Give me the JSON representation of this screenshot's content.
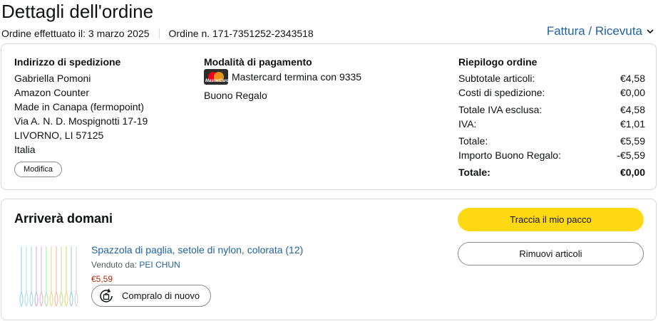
{
  "header": {
    "title": "Dettagli dell'ordine",
    "order_date": "Ordine effettuato il: 3 marzo 2025",
    "order_number": "Ordine n. 171-7351252-2343518",
    "invoice_link": "Fattura / Ricevuta"
  },
  "shipping": {
    "heading": "Indirizzo di spedizione",
    "lines": [
      "Gabriella Pomoni",
      "Amazon Counter",
      "Made in Canapa (fermopoint)",
      "Via A. N. D. Mospignotti 17-19",
      "LIVORNO, LI 57125",
      "Italia"
    ],
    "modify_label": "Modifica"
  },
  "payment": {
    "heading": "Modalità di pagamento",
    "card_text": "Mastercard termina con 9335",
    "card_logo_text": "MasterCard",
    "gift_card": "Buono Regalo"
  },
  "summary": {
    "heading": "Riepilogo ordine",
    "rows": [
      {
        "label": "Subtotale articoli:",
        "value": "€4,58"
      },
      {
        "label": "Costi di spedizione:",
        "value": "€0,00"
      },
      {
        "label": "Totale IVA esclusa:",
        "value": "€4,58"
      },
      {
        "label": "IVA:",
        "value": "€1,01"
      },
      {
        "label": "Totale:",
        "value": "€5,59"
      },
      {
        "label": "Importo Buono Regalo:",
        "value": "-€5,59"
      }
    ],
    "grand_total": {
      "label": "Totale:",
      "value": "€0,00"
    }
  },
  "shipment": {
    "title": "Arriverà domani",
    "product_name": "Spazzola di paglia, setole di nylon, colorata (12)",
    "seller_prefix": "Venduto da:",
    "seller_name": "PEI CHUN",
    "price": "€5,59",
    "buy_again_label": "Compralo di nuovo",
    "track_label": "Traccia il mio pacco",
    "remove_label": "Rimuovi articoli"
  },
  "colors": {
    "link": "#2162a1",
    "price": "#b12704",
    "primary_button": "#ffd814",
    "border": "#d5d9d9"
  }
}
